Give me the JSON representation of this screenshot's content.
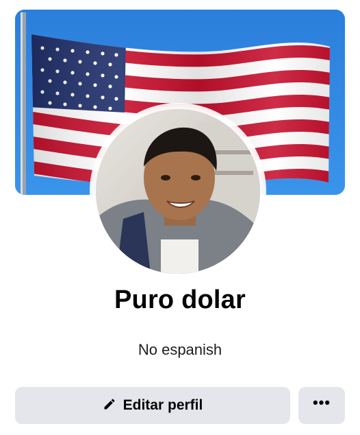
{
  "profile": {
    "name": "Puro dolar",
    "bio": "No espanish"
  },
  "actions": {
    "edit_label": "Editar perfil",
    "edit_icon": "pencil-icon",
    "more_label": "•••",
    "more_icon": "ellipsis-icon"
  },
  "colors": {
    "button_bg": "#e4e6eb",
    "text_primary": "#050505",
    "sky": "#2f86e0",
    "flag_red": "#c8102e",
    "flag_blue": "#1f2f6b"
  },
  "cover": {
    "content": "american-flag"
  }
}
